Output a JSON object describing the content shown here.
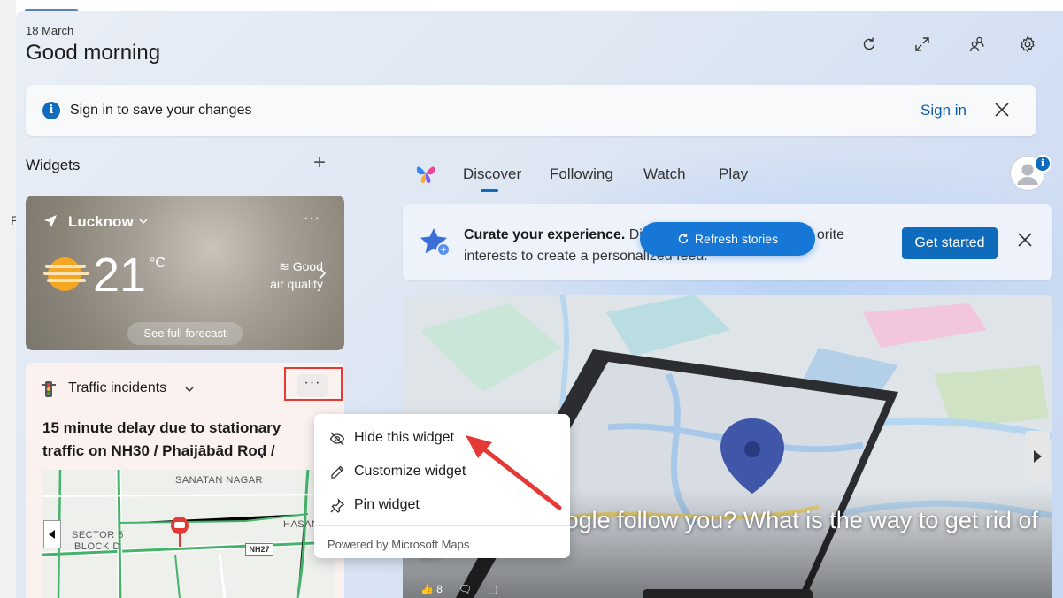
{
  "header": {
    "date": "18 March",
    "greeting": "Good morning"
  },
  "icons": {
    "refresh": "refresh-icon",
    "expand": "expand-icon",
    "people": "people-icon",
    "settings": "gear-icon"
  },
  "signin_bar": {
    "message": "Sign in to save your changes",
    "link": "Sign in"
  },
  "widgets_section": {
    "title": "Widgets",
    "add_label": "+"
  },
  "weather": {
    "city": "Lucknow",
    "temperature": "21",
    "unit": "°C",
    "air_quality_line1": "Good",
    "air_quality_line2": "air quality",
    "forecast_button": "See full forecast",
    "more": "···"
  },
  "traffic": {
    "title": "Traffic incidents",
    "more": "···",
    "headline": "15 minute delay due to stationary traffic on NH30 / Phaijābād Roḍ /",
    "map_labels": {
      "area1": "SANATAN NAGAR",
      "area2_line1": "SECTOR 5",
      "area2_line2": "BLOCK D",
      "area3": "HASAN",
      "highway": "NH27"
    }
  },
  "context_menu": {
    "items": [
      {
        "label": "Hide this widget",
        "icon": "eye-off-icon"
      },
      {
        "label": "Customize widget",
        "icon": "pencil-icon"
      },
      {
        "label": "Pin widget",
        "icon": "pin-icon"
      }
    ],
    "footer": "Powered by Microsoft Maps"
  },
  "feed": {
    "tabs": [
      {
        "label": "Discover",
        "active": true
      },
      {
        "label": "Following"
      },
      {
        "label": "Watch"
      },
      {
        "label": "Play"
      }
    ],
    "avatar_badge": "i"
  },
  "curate": {
    "bold": "Curate your experience.",
    "text_line1_visible": "Di",
    "text_line1_end": "orite",
    "text_line2": "interests to create a personalized feed.",
    "button": "Get started"
  },
  "refresh_stories": {
    "label": "Refresh stories"
  },
  "story": {
    "headline": "How does Google follow you? What is the way to get rid of it?",
    "likes": "8"
  },
  "colors": {
    "accent": "#0f6cbd",
    "button_blue": "#1677d6",
    "annotation_red": "#e53935"
  }
}
